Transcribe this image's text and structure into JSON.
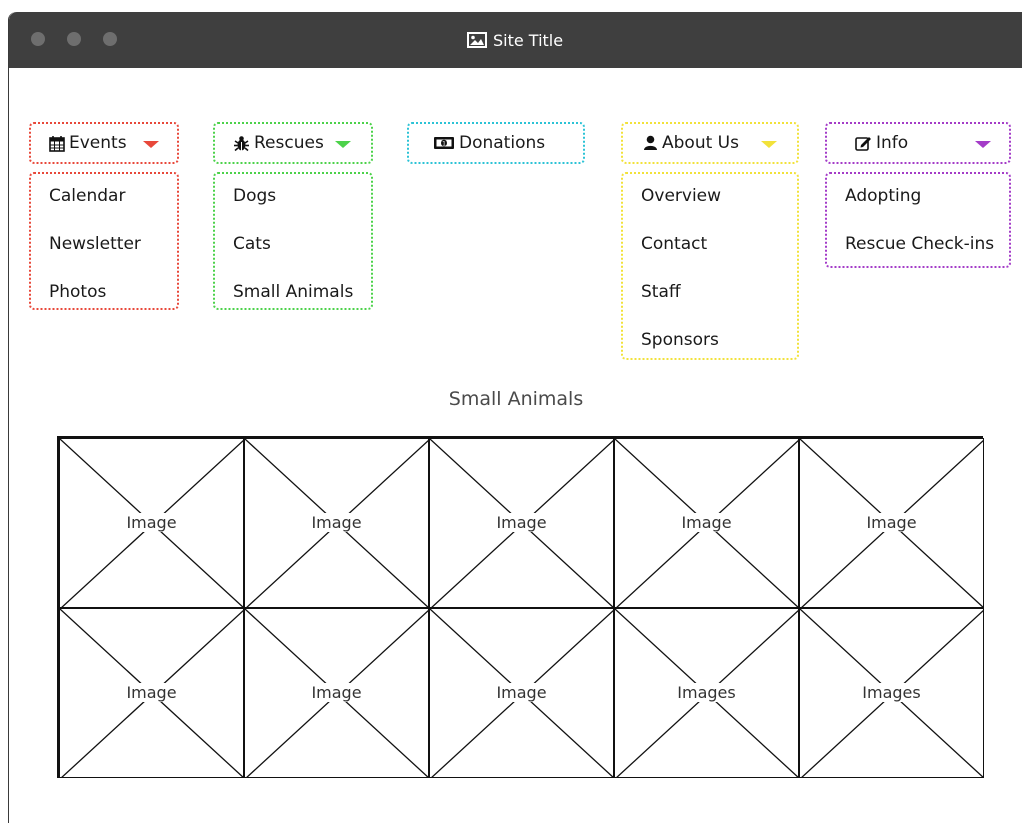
{
  "window": {
    "title": "Site Title",
    "title_icon": "image-icon"
  },
  "menus": [
    {
      "id": "events",
      "label": "Events",
      "icon": "calendar-icon",
      "color": "#e8483a",
      "items": [
        "Calendar",
        "Newsletter",
        "Photos"
      ]
    },
    {
      "id": "rescues",
      "label": "Rescues",
      "icon": "bug-icon",
      "color": "#4cd24a",
      "items": [
        "Dogs",
        "Cats",
        "Small Animals"
      ]
    },
    {
      "id": "donations",
      "label": "Donations",
      "icon": "money-icon",
      "color": "#2cc3d6",
      "items": []
    },
    {
      "id": "about",
      "label": "About Us",
      "icon": "user-icon",
      "color": "#f2e23a",
      "items": [
        "Overview",
        "Contact",
        "Staff",
        "Sponsors"
      ]
    },
    {
      "id": "info",
      "label": "Info",
      "icon": "edit-icon",
      "color": "#a43cc8",
      "items": [
        "Adopting",
        "Rescue Check-ins"
      ]
    }
  ],
  "gallery": {
    "title": "Small Animals",
    "cells": [
      "Image",
      "Image",
      "Image",
      "Image",
      "Image",
      "Image",
      "Image",
      "Image",
      "Images",
      "Images"
    ]
  }
}
